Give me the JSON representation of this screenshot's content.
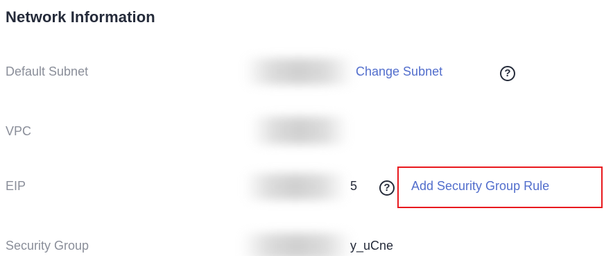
{
  "section": {
    "title": "Network Information"
  },
  "rows": {
    "default_subnet": {
      "label": "Default Subnet",
      "action_label": "Change Subnet",
      "help_icon": "question-circle-icon"
    },
    "vpc": {
      "label": "VPC"
    },
    "eip": {
      "label": "EIP",
      "value_fragment": "5",
      "help_icon": "question-circle-icon",
      "action_label": "Add Security Group Rule"
    },
    "security_group": {
      "label": "Security Group",
      "value_fragment": "y_uCne"
    }
  },
  "help_glyph": "?",
  "colors": {
    "link": "#526ecc",
    "label": "#8a8e99",
    "text": "#252b3a",
    "highlight": "#e8191e"
  }
}
